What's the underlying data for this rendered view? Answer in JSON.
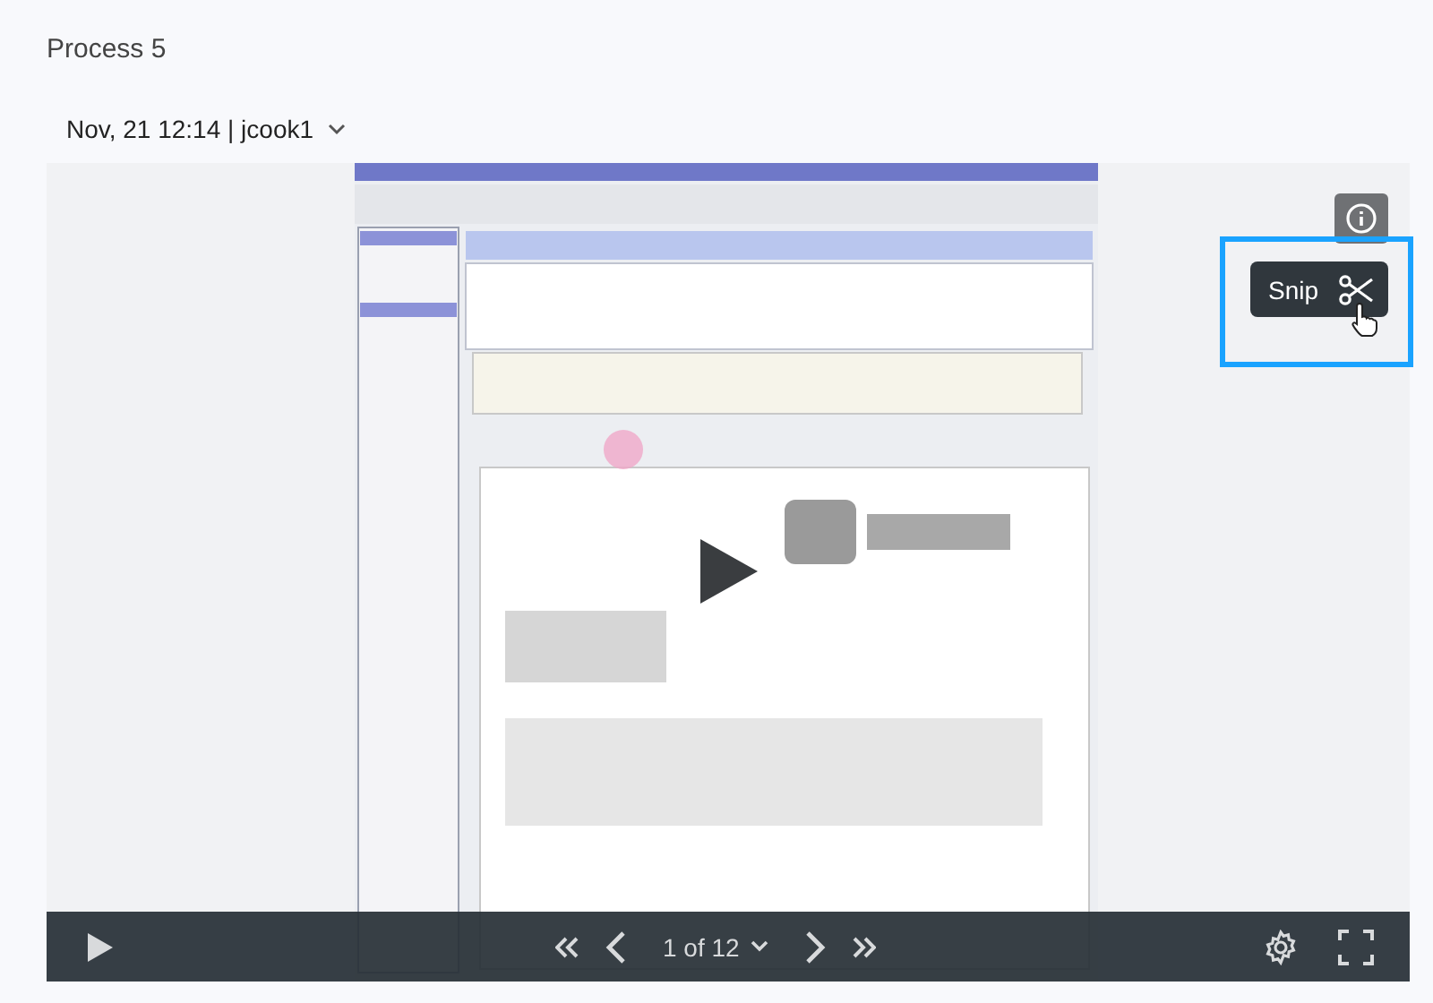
{
  "title": "Process 5",
  "session": {
    "label": "Nov, 21 12:14 | jcook1"
  },
  "player": {
    "snip": {
      "label": "Snip",
      "highlighted": true
    },
    "pager": {
      "label": "1 of 12"
    }
  }
}
